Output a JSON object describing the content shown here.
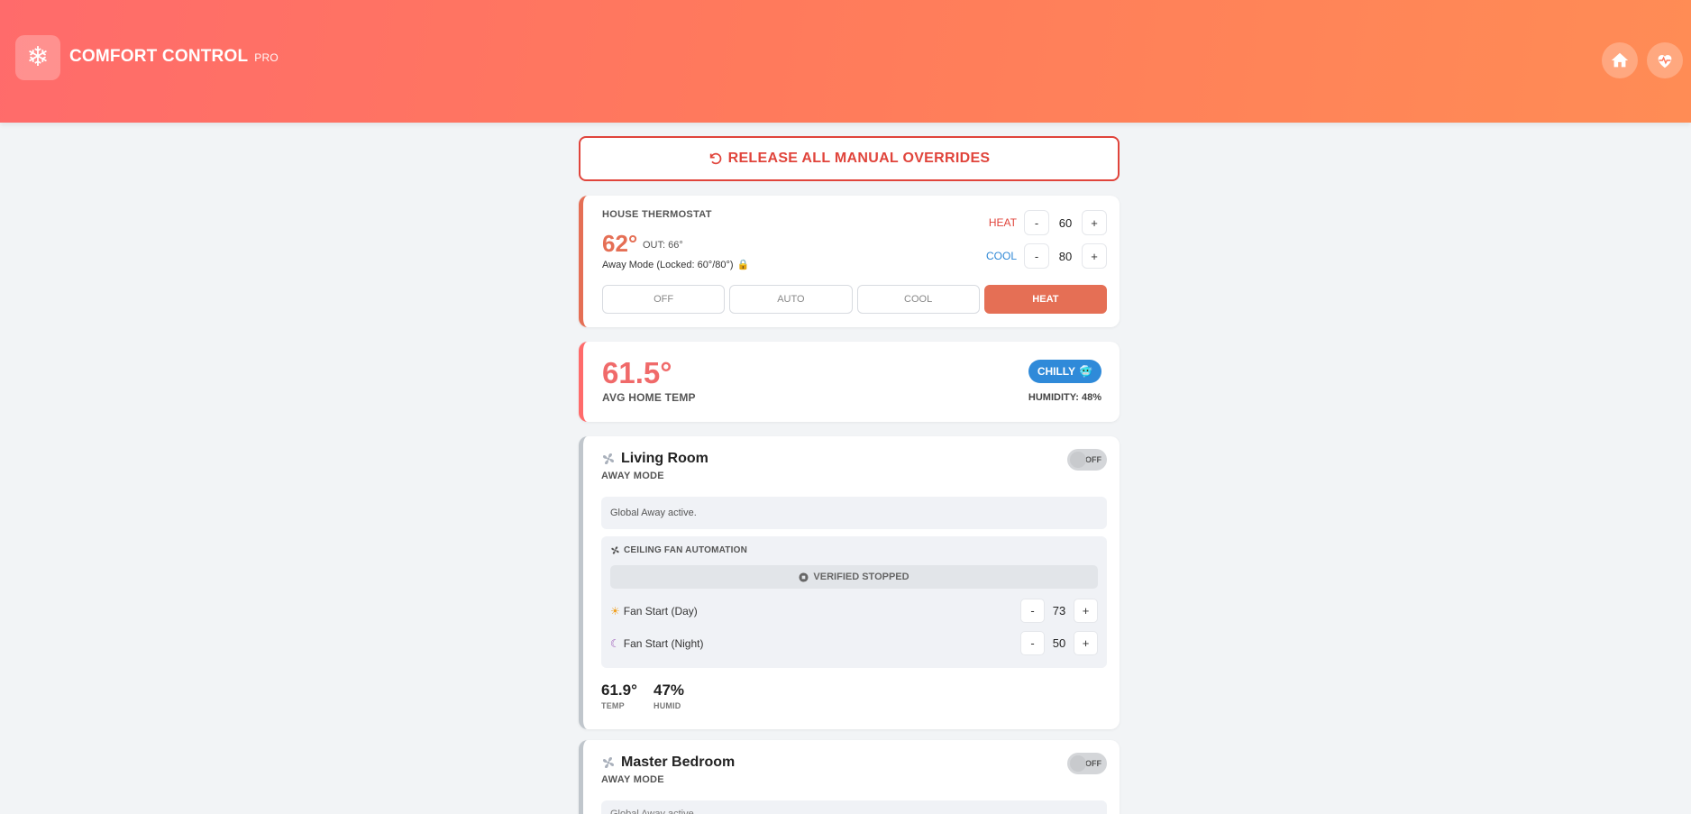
{
  "header": {
    "logo_icon": "snowflake-icon",
    "title": "COMFORT CONTROL",
    "badge": "PRO",
    "buttons": [
      "home-icon",
      "heart-pulse-icon"
    ]
  },
  "release": {
    "label": "RELEASE ALL MANUAL OVERRIDES",
    "icon": "undo-icon"
  },
  "thermostat": {
    "label": "HOUSE THERMOSTAT",
    "current_temp": "62°",
    "outside": "OUT: 66°",
    "away_text": "Away Mode (Locked: 60°/80°)",
    "lock_icon": "lock-icon",
    "heat_label": "HEAT",
    "heat_value": "60",
    "cool_label": "COOL",
    "cool_value": "80",
    "minus": "-",
    "plus": "+",
    "modes": [
      "OFF",
      "AUTO",
      "COOL",
      "HEAT"
    ],
    "active_mode": "HEAT"
  },
  "average": {
    "temp": "61.5°",
    "label": "AVG HOME TEMP",
    "status": "CHILLY",
    "status_icon": "cold-face-icon",
    "humidity": "HUMIDITY: 48%"
  },
  "rooms": [
    {
      "name": "Living Room",
      "mode": "AWAY MODE",
      "toggle": "OFF",
      "info": "Global Away active.",
      "fan": {
        "title": "CEILING FAN AUTOMATION",
        "status": "VERIFIED STOPPED",
        "day_label": "Fan Start (Day)",
        "day_value": "73",
        "night_label": "Fan Start (Night)",
        "night_value": "50"
      },
      "temp": "61.9°",
      "temp_label": "TEMP",
      "humid": "47%",
      "humid_label": "HUMID"
    },
    {
      "name": "Master Bedroom",
      "mode": "AWAY MODE",
      "toggle": "OFF",
      "info": "Global Away active."
    }
  ],
  "colors": {
    "header_start": "#ff6b6b",
    "header_end": "#ff8c55",
    "accent": "#e56f55",
    "danger": "#e0443b",
    "cool": "#2f88d6"
  }
}
